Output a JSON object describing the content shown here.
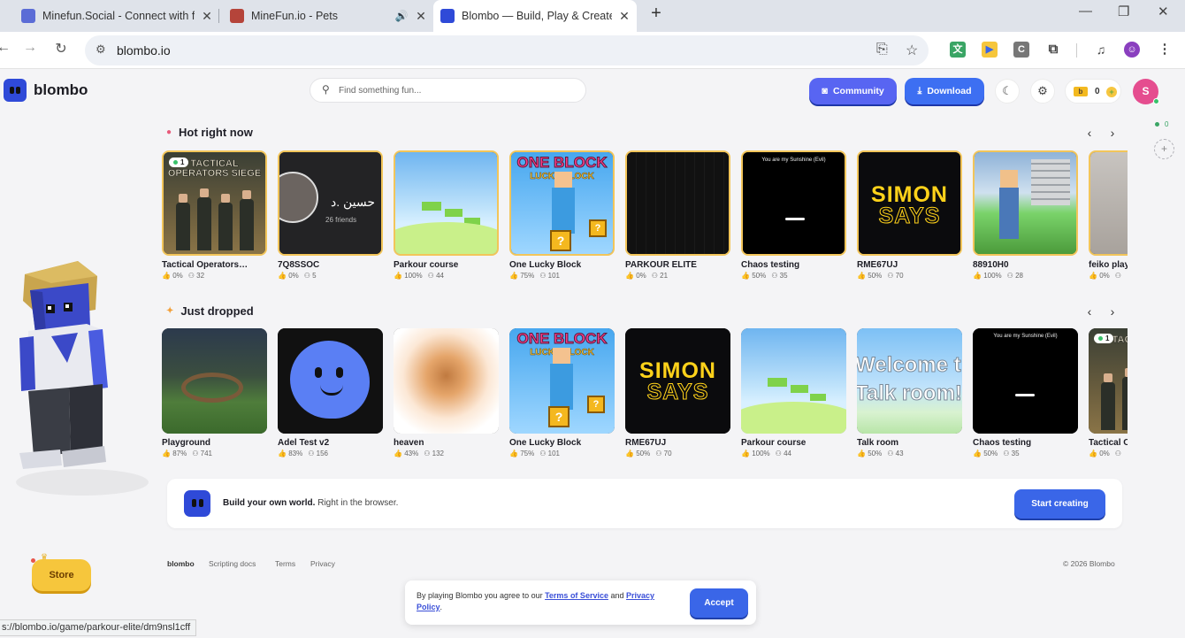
{
  "browser": {
    "tabs": [
      {
        "title": "Minefun.Social - Connect with f",
        "icon": "minefun-social-icon"
      },
      {
        "title": "MineFun.io - Pets",
        "icon": "minefun-pets-icon"
      },
      {
        "title": "Blombo — Build, Play & Create",
        "icon": "blombo-icon",
        "active": true
      }
    ],
    "url": "blombo.io",
    "status_url": "s://blombo.io/game/parkour-elite/dm9nsl1cff"
  },
  "header": {
    "logo": "blombo",
    "search_placeholder": "Find something fun...",
    "community_label": "Community",
    "download_label": "Download",
    "coins": "0",
    "coin_badge": "b",
    "avatar_initial": "S"
  },
  "rail": {
    "online_count": "0"
  },
  "sections": {
    "hot": {
      "title": "Hot right now",
      "items": [
        {
          "name": "Tactical Operators…",
          "rating": "0%",
          "players": "32",
          "art": "tactical",
          "badge": "1",
          "art_text": "TACTICAL OPERATORS SIEGE"
        },
        {
          "name": "7Q8SSOC",
          "rating": "0%",
          "players": "5",
          "art": "dark-friends",
          "art_text": "حسين .د",
          "art_sub": "26 friends"
        },
        {
          "name": "Parkour course",
          "rating": "100%",
          "players": "44",
          "art": "sky"
        },
        {
          "name": "One Lucky Block",
          "rating": "75%",
          "players": "101",
          "art": "lucky",
          "art_text": "ONE BLOCK",
          "art_sub": "LUCKY BLOCK"
        },
        {
          "name": "PARKOUR ELITE",
          "rating": "0%",
          "players": "21",
          "art": "parkour-elite"
        },
        {
          "name": "Chaos testing",
          "rating": "50%",
          "players": "35",
          "art": "chaos",
          "art_text": "You are my Sunshine (Evil)"
        },
        {
          "name": "RME67UJ",
          "rating": "50%",
          "players": "70",
          "art": "simon",
          "art_text": "SIMON",
          "art_sub": "SAYS"
        },
        {
          "name": "88910H0",
          "rating": "100%",
          "players": "28",
          "art": "town"
        },
        {
          "name": "feiko play",
          "rating": "0%",
          "players": "",
          "art": "cat"
        }
      ]
    },
    "dropped": {
      "title": "Just dropped",
      "items": [
        {
          "name": "Playground",
          "rating": "87%",
          "players": "741",
          "art": "playground"
        },
        {
          "name": "Adel Test v2",
          "rating": "83%",
          "players": "156",
          "art": "blob"
        },
        {
          "name": "heaven",
          "rating": "43%",
          "players": "132",
          "art": "heaven"
        },
        {
          "name": "One Lucky Block",
          "rating": "75%",
          "players": "101",
          "art": "lucky",
          "art_text": "ONE BLOCK",
          "art_sub": "LUCKY BLOCK"
        },
        {
          "name": "RME67UJ",
          "rating": "50%",
          "players": "70",
          "art": "simon",
          "art_text": "SIMON",
          "art_sub": "SAYS"
        },
        {
          "name": "Parkour course",
          "rating": "100%",
          "players": "44",
          "art": "sky"
        },
        {
          "name": "Talk room",
          "rating": "50%",
          "players": "43",
          "art": "talk",
          "art_text": "Welcome t",
          "art_sub": "Talk room!"
        },
        {
          "name": "Chaos testing",
          "rating": "50%",
          "players": "35",
          "art": "chaos",
          "art_text": "You are my Sunshine (Evil)"
        },
        {
          "name": "Tactical O",
          "rating": "0%",
          "players": "",
          "art": "tactical",
          "badge": "1",
          "art_text": "TACTI OPER"
        }
      ]
    }
  },
  "promo": {
    "bold": "Build your own world.",
    "rest": "Right in the browser.",
    "button": "Start creating"
  },
  "footer": {
    "brand": "blombo",
    "links": [
      "Scripting docs",
      "Terms",
      "Privacy"
    ],
    "copyright": "© 2026 Blombo"
  },
  "store": {
    "label": "Store"
  },
  "cookie": {
    "prefix": "By playing Blombo you agree to our ",
    "terms": "Terms of Service",
    "and": " and ",
    "privacy": "Privacy Policy",
    "suffix": ".",
    "accept": "Accept"
  }
}
